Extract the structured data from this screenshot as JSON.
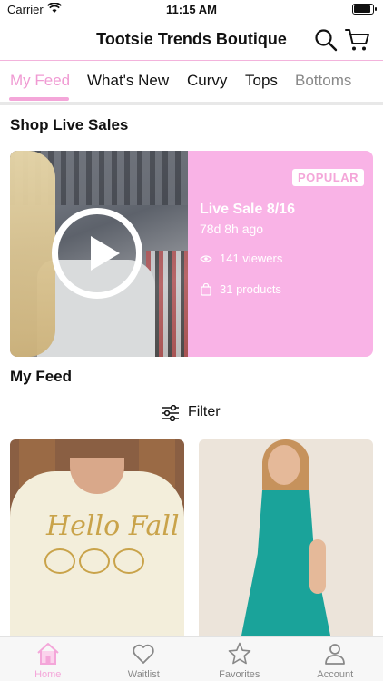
{
  "status_bar": {
    "carrier": "Carrier",
    "time": "11:15 AM"
  },
  "header": {
    "title": "Tootsie Trends Boutique"
  },
  "tabs": [
    {
      "label": "My Feed",
      "active": true
    },
    {
      "label": "What's New"
    },
    {
      "label": "Curvy"
    },
    {
      "label": "Tops"
    },
    {
      "label": "Bottoms"
    }
  ],
  "live_section": {
    "title": "Shop Live Sales",
    "card": {
      "badge": "POPULAR",
      "title": "Live Sale 8/16",
      "time": "78d 8h ago",
      "viewers": "141 viewers",
      "products": "31 products"
    }
  },
  "feed_section": {
    "title": "My Feed",
    "filter_label": "Filter"
  },
  "products": [
    {
      "print_text": "Hello Fall"
    }
  ],
  "bottom_tabs": [
    {
      "label": "Home",
      "icon": "home-icon",
      "active": true
    },
    {
      "label": "Waitlist",
      "icon": "heart-icon"
    },
    {
      "label": "Favorites",
      "icon": "star-icon"
    },
    {
      "label": "Account",
      "icon": "person-icon"
    }
  ],
  "colors": {
    "accent": "#f4a6d9",
    "card_bg": "#f9b3e6",
    "badge_text": "#f4a6d9"
  }
}
